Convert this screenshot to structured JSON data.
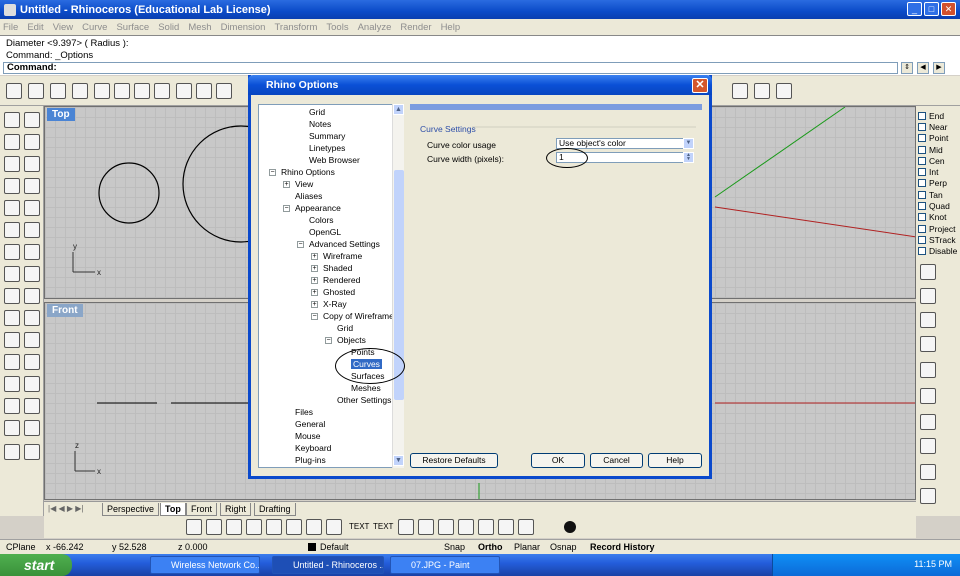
{
  "app": {
    "title": "Untitled - Rhinoceros (Educational Lab License)",
    "min": "_",
    "max": "□",
    "close": "✕"
  },
  "menu": [
    "File",
    "Edit",
    "View",
    "Curve",
    "Surface",
    "Solid",
    "Mesh",
    "Dimension",
    "Transform",
    "Tools",
    "Analyze",
    "Render",
    "Help"
  ],
  "command": {
    "line1": "Diameter <9.397> ( Radius ):",
    "line2": "Command: _Options",
    "prompt": "Command:"
  },
  "viewports": {
    "top": "Top",
    "front": "Front"
  },
  "osnap": [
    "End",
    "Near",
    "Point",
    "Mid",
    "Cen",
    "Int",
    "Perp",
    "Tan",
    "Quad",
    "Knot",
    "Project",
    "STrack",
    "Disable"
  ],
  "viewtabs": [
    "Perspective",
    "Top",
    "Front",
    "Right",
    "Drafting"
  ],
  "statusbar": {
    "cplane": "CPlane",
    "x": "x -66.242",
    "y": "y 52.528",
    "z": "z 0.000",
    "layer": "Default",
    "snap": "Snap",
    "ortho": "Ortho",
    "planar": "Planar",
    "osnap": "Osnap",
    "record": "Record History"
  },
  "taskbar": {
    "start": "start",
    "tasks": [
      "Wireless Network Co...",
      "Untitled - Rhinoceros ...",
      "07.JPG - Paint"
    ],
    "clock": "11:15 PM"
  },
  "bottom_toolbar": {
    "text1": "TEXT",
    "text2": "TEXT"
  },
  "dialog": {
    "title": "Rhino Options",
    "tree": [
      {
        "label": "Grid",
        "level": 2
      },
      {
        "label": "Notes",
        "level": 2
      },
      {
        "label": "Summary",
        "level": 2
      },
      {
        "label": "Linetypes",
        "level": 2
      },
      {
        "label": "Web Browser",
        "level": 2
      },
      {
        "label": "Rhino Options",
        "level": 0,
        "expander": "−"
      },
      {
        "label": "View",
        "level": 1,
        "expander": "+"
      },
      {
        "label": "Aliases",
        "level": 1
      },
      {
        "label": "Appearance",
        "level": 1,
        "expander": "−"
      },
      {
        "label": "Colors",
        "level": 2
      },
      {
        "label": "OpenGL",
        "level": 2
      },
      {
        "label": "Advanced Settings",
        "level": 2,
        "expander": "−"
      },
      {
        "label": "Wireframe",
        "level": 3,
        "expander": "+"
      },
      {
        "label": "Shaded",
        "level": 3,
        "expander": "+"
      },
      {
        "label": "Rendered",
        "level": 3,
        "expander": "+"
      },
      {
        "label": "Ghosted",
        "level": 3,
        "expander": "+"
      },
      {
        "label": "X-Ray",
        "level": 3,
        "expander": "+"
      },
      {
        "label": "Copy of Wireframe",
        "level": 3,
        "expander": "−"
      },
      {
        "label": "Grid",
        "level": 4
      },
      {
        "label": "Objects",
        "level": 4,
        "expander": "−"
      },
      {
        "label": "Points",
        "level": 5
      },
      {
        "label": "Curves",
        "level": 5,
        "selected": true
      },
      {
        "label": "Surfaces",
        "level": 5
      },
      {
        "label": "Meshes",
        "level": 5
      },
      {
        "label": "Other Settings",
        "level": 4
      },
      {
        "label": "Files",
        "level": 1
      },
      {
        "label": "General",
        "level": 1
      },
      {
        "label": "Mouse",
        "level": 1
      },
      {
        "label": "Keyboard",
        "level": 1
      },
      {
        "label": "Plug-ins",
        "level": 1
      }
    ],
    "section": "Curve Settings",
    "color_label": "Curve color usage",
    "color_value": "Use object's color",
    "width_label": "Curve width (pixels):",
    "width_value": "1",
    "restore": "Restore Defaults",
    "ok": "OK",
    "cancel": "Cancel",
    "help": "Help"
  }
}
